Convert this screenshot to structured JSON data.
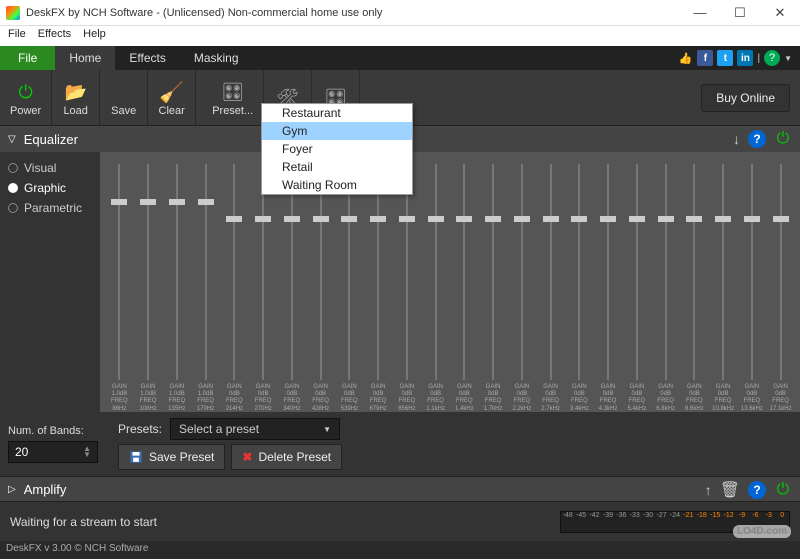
{
  "window": {
    "title": "DeskFX by NCH Software - (Unlicensed) Non-commercial home use only"
  },
  "menubar": {
    "file": "File",
    "effects": "Effects",
    "help": "Help"
  },
  "tabs": {
    "file": "File",
    "home": "Home",
    "effects": "Effects",
    "masking": "Masking"
  },
  "toolbar": {
    "power": "Power",
    "load": "Load",
    "save": "Save",
    "clear": "Clear",
    "presets": "Preset...",
    "tools": "",
    "add": "",
    "buy": "Buy Online"
  },
  "dropdown": {
    "items": [
      "Restaurant",
      "Gym",
      "Foyer",
      "Retail",
      "Waiting Room"
    ],
    "hover_index": 1
  },
  "equalizer": {
    "title": "Equalizer",
    "modes": [
      "Visual",
      "Graphic",
      "Parametric"
    ],
    "selected_mode": 1,
    "bands": [
      {
        "freq": "86Hz",
        "gain": "1.0dB"
      },
      {
        "freq": "108Hz",
        "gain": "1.0dB"
      },
      {
        "freq": "135Hz",
        "gain": "1.0dB"
      },
      {
        "freq": "170Hz",
        "gain": "1.0dB"
      },
      {
        "freq": "214Hz",
        "gain": "0dB"
      },
      {
        "freq": "270Hz",
        "gain": "0dB"
      },
      {
        "freq": "340Hz",
        "gain": "0dB"
      },
      {
        "freq": "428Hz",
        "gain": "0dB"
      },
      {
        "freq": "539Hz",
        "gain": "0dB"
      },
      {
        "freq": "679Hz",
        "gain": "0dB"
      },
      {
        "freq": "856Hz",
        "gain": "0dB"
      },
      {
        "freq": "1.1kHz",
        "gain": "0dB"
      },
      {
        "freq": "1.4kHz",
        "gain": "0dB"
      },
      {
        "freq": "1.7kHz",
        "gain": "0dB"
      },
      {
        "freq": "2.2kHz",
        "gain": "0dB"
      },
      {
        "freq": "2.7kHz",
        "gain": "0dB"
      },
      {
        "freq": "3.4kHz",
        "gain": "0dB"
      },
      {
        "freq": "4.3kHz",
        "gain": "0dB"
      },
      {
        "freq": "5.4kHz",
        "gain": "0dB"
      },
      {
        "freq": "6.8kHz",
        "gain": "0dB"
      },
      {
        "freq": "8.6kHz",
        "gain": "0dB"
      },
      {
        "freq": "10.8kHz",
        "gain": "0dB"
      },
      {
        "freq": "13.6kHz",
        "gain": "0dB"
      },
      {
        "freq": "17.1kHz",
        "gain": "0dB"
      }
    ],
    "num_bands_label": "Num. of Bands:",
    "num_bands": "20",
    "presets_label": "Presets:",
    "preset_placeholder": "Select a preset",
    "save_preset": "Save Preset",
    "delete_preset": "Delete Preset"
  },
  "amplify": {
    "title": "Amplify"
  },
  "status": {
    "text": "Waiting for a stream to start"
  },
  "meter_ticks": [
    "-48",
    "-45",
    "-42",
    "-39",
    "-36",
    "-33",
    "-30",
    "-27",
    "-24",
    "-21",
    "-18",
    "-15",
    "-12",
    "-9",
    "-6",
    "-3",
    "0"
  ],
  "footer": "DeskFX v 3.00 © NCH Software",
  "watermark": "LO4D.com"
}
